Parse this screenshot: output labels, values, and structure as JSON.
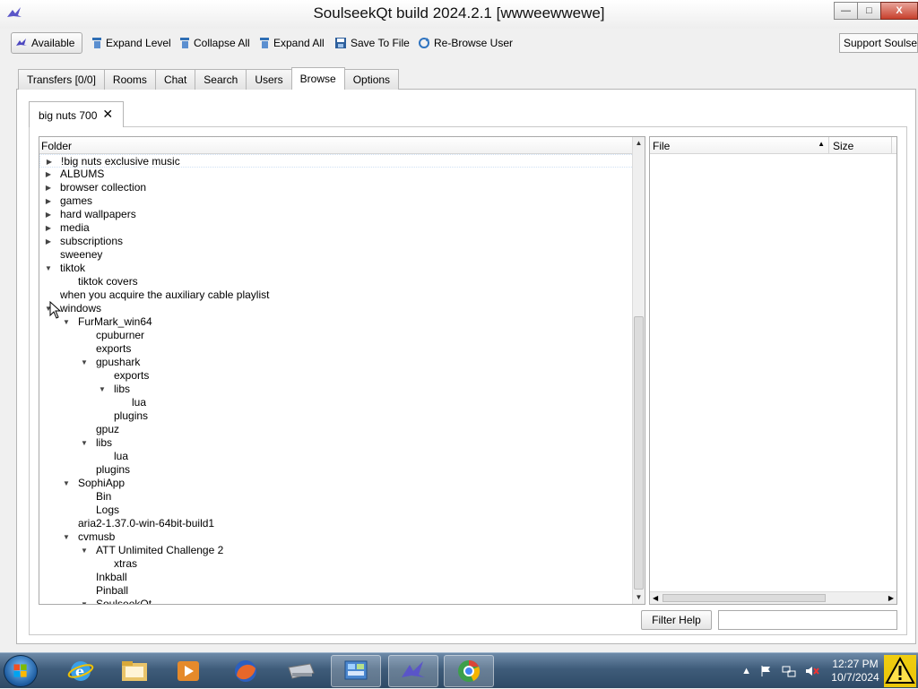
{
  "window": {
    "title": "SoulseekQt build 2024.2.1 [wwweewwewe]",
    "minimize": "—",
    "maximize": "□",
    "close": "X"
  },
  "toolbar": {
    "available": "Available",
    "expand_level": "Expand Level",
    "collapse_all": "Collapse All",
    "expand_all": "Expand All",
    "save_to_file": "Save To File",
    "rebrowse_user": "Re-Browse User",
    "support": "Support Soulseek"
  },
  "main_tabs": [
    {
      "label": "Transfers [0/0]"
    },
    {
      "label": "Rooms"
    },
    {
      "label": "Chat"
    },
    {
      "label": "Search"
    },
    {
      "label": "Users"
    },
    {
      "label": "Browse"
    },
    {
      "label": "Options"
    }
  ],
  "active_main_tab": "Browse",
  "browse": {
    "user_tab": "big nuts 700",
    "user_tab_close": "✕",
    "folder_header": "Folder",
    "file_header": "File",
    "size_header": "Size",
    "filter_help": "Filter Help",
    "filter_value": ""
  },
  "tree": [
    {
      "label": "!big nuts exclusive music",
      "depth": 0,
      "state": "collapsed"
    },
    {
      "label": "ALBUMS",
      "depth": 0,
      "state": "collapsed"
    },
    {
      "label": "browser collection",
      "depth": 0,
      "state": "collapsed"
    },
    {
      "label": "games",
      "depth": 0,
      "state": "collapsed"
    },
    {
      "label": "hard wallpapers",
      "depth": 0,
      "state": "collapsed"
    },
    {
      "label": "media",
      "depth": 0,
      "state": "collapsed"
    },
    {
      "label": "subscriptions",
      "depth": 0,
      "state": "collapsed"
    },
    {
      "label": "sweeney",
      "depth": 0,
      "state": "leaf"
    },
    {
      "label": "tiktok",
      "depth": 0,
      "state": "expanded"
    },
    {
      "label": "tiktok covers",
      "depth": 1,
      "state": "leaf"
    },
    {
      "label": "when you acquire the auxiliary cable playlist",
      "depth": 0,
      "state": "leaf"
    },
    {
      "label": "windows",
      "depth": 0,
      "state": "expanded"
    },
    {
      "label": "FurMark_win64",
      "depth": 1,
      "state": "expanded"
    },
    {
      "label": "cpuburner",
      "depth": 2,
      "state": "leaf"
    },
    {
      "label": "exports",
      "depth": 2,
      "state": "leaf"
    },
    {
      "label": "gpushark",
      "depth": 2,
      "state": "expanded"
    },
    {
      "label": "exports",
      "depth": 3,
      "state": "leaf"
    },
    {
      "label": "libs",
      "depth": 3,
      "state": "expanded"
    },
    {
      "label": "lua",
      "depth": 4,
      "state": "leaf"
    },
    {
      "label": "plugins",
      "depth": 3,
      "state": "leaf"
    },
    {
      "label": "gpuz",
      "depth": 2,
      "state": "leaf"
    },
    {
      "label": "libs",
      "depth": 2,
      "state": "expanded"
    },
    {
      "label": "lua",
      "depth": 3,
      "state": "leaf"
    },
    {
      "label": "plugins",
      "depth": 2,
      "state": "leaf"
    },
    {
      "label": "SophiApp",
      "depth": 1,
      "state": "expanded"
    },
    {
      "label": "Bin",
      "depth": 2,
      "state": "leaf"
    },
    {
      "label": "Logs",
      "depth": 2,
      "state": "leaf"
    },
    {
      "label": "aria2-1.37.0-win-64bit-build1",
      "depth": 1,
      "state": "leaf"
    },
    {
      "label": "cvmusb",
      "depth": 1,
      "state": "expanded"
    },
    {
      "label": "ATT Unlimited Challenge 2",
      "depth": 2,
      "state": "expanded"
    },
    {
      "label": "xtras",
      "depth": 3,
      "state": "leaf"
    },
    {
      "label": "Inkball",
      "depth": 2,
      "state": "leaf"
    },
    {
      "label": "Pinball",
      "depth": 2,
      "state": "leaf"
    },
    {
      "label": "SoulseekQt",
      "depth": 2,
      "state": "expanded"
    }
  ],
  "taskbar": {
    "apps": [
      "start-orb",
      "internet-explorer",
      "file-explorer",
      "media-player",
      "firefox",
      "drive",
      "control-panel",
      "soulseek",
      "chrome"
    ],
    "time": "12:27 PM",
    "date": "10/7/2024"
  },
  "colors": {
    "taskbar": "#3f5c7a",
    "selection_outline": "#cfe0f3",
    "window_bg": "#f0f0f0"
  }
}
